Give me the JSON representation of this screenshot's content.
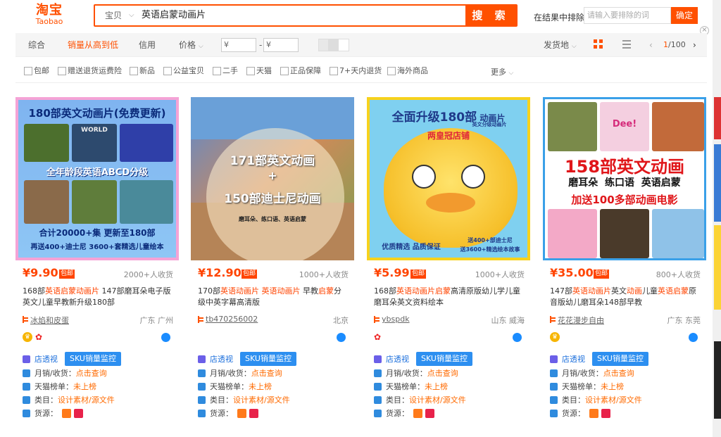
{
  "logo": {
    "cn": "淘宝",
    "en": "Taobao"
  },
  "search": {
    "scope": "宝贝",
    "query": "英语启蒙动画片",
    "button": "搜 索"
  },
  "exclude": {
    "label": "在结果中排除",
    "placeholder": "请输入要排除的词",
    "button": "确定"
  },
  "sort": {
    "items": [
      "综合",
      "销量从高到低",
      "信用",
      "价格"
    ],
    "active_index": 1,
    "price_from": "¥",
    "price_to": "¥",
    "ship_from": "发货地",
    "page_current": "1",
    "page_total": "/100"
  },
  "filters": [
    "包邮",
    "赠送退货运费险",
    "新品",
    "公益宝贝",
    "二手",
    "天猫",
    "正品保障",
    "7+天内退货",
    "海外商品"
  ],
  "filters_more": "更多",
  "tools": {
    "shop_view": "店透视",
    "sku": "SKU销量监控",
    "monthly_label": "月销/收货：",
    "monthly_value": "点击查询",
    "tmall_label": "天猫榜单：",
    "tmall_value": "未上榜",
    "category_label": "类目：",
    "category_value": "设计素材/源文件",
    "source_label": "货源："
  },
  "products": [
    {
      "poster_lines": [
        "180部英文动画片(免费更新)",
        "WORLD",
        "全年龄段英语ABCD分级",
        "合计20000+集  更新至180部",
        "再送400+迪士尼  3600+套精选儿童绘本"
      ],
      "price": "¥9.90",
      "baoyou": "包邮",
      "sold": "2000+人收货",
      "title_segments": [
        [
          "168部",
          ""
        ],
        [
          "英语启蒙动画片",
          "hl"
        ],
        [
          " 147部磨耳朵电子版英文儿童早教新升级180部",
          ""
        ]
      ],
      "shop": "冰焰和皮蛋",
      "location": "广东 广州",
      "badges": [
        "crown",
        "flower",
        "wangwang"
      ]
    },
    {
      "poster_lines": [
        "171部英文动画",
        "+",
        "150部迪士尼动画",
        "磨耳朵、练口语、英语启蒙"
      ],
      "price": "¥12.90",
      "baoyou": "包邮",
      "sold": "1000+人收货",
      "title_segments": [
        [
          "170部",
          ""
        ],
        [
          "英语动画片",
          "hl"
        ],
        [
          " ",
          ""
        ],
        [
          "英语动画片",
          "hl"
        ],
        [
          " 早教",
          ""
        ],
        [
          "启蒙",
          "hl"
        ],
        [
          "分级中英字幕高清版",
          ""
        ]
      ],
      "shop": "tb470256002",
      "location": "北京",
      "badges": [
        "wangwang"
      ]
    },
    {
      "poster_lines": [
        "全面升级180部",
        "动画片",
        "英文分级动画片",
        "两皇冠店铺",
        "优质精选 品质保证",
        "送400+部迪士尼",
        "送3600+精选绘本故事"
      ],
      "price": "¥5.99",
      "baoyou": "包邮",
      "sold": "1000+人收货",
      "title_segments": [
        [
          "168部",
          ""
        ],
        [
          "英语动画片",
          "hl"
        ],
        [
          "启蒙",
          "hl"
        ],
        [
          "高清原版幼儿学儿童磨耳朵英文资料绘本",
          ""
        ]
      ],
      "shop": "ybspdk",
      "location": "山东 威海",
      "badges": [
        "flower",
        "wangwang"
      ]
    },
    {
      "poster_lines": [
        "158部英文动画",
        "磨耳朵",
        "练口语",
        "英语启蒙",
        "加送100多部动画电影",
        "Dee!"
      ],
      "price": "¥35.00",
      "baoyou": "包邮",
      "sold": "800+人收货",
      "title_segments": [
        [
          "147部",
          ""
        ],
        [
          "英语动画片",
          "hl"
        ],
        [
          "英文",
          ""
        ],
        [
          "动画",
          "hl"
        ],
        [
          "儿童",
          ""
        ],
        [
          "英语启蒙",
          "hl"
        ],
        [
          "原音版幼儿磨耳朵148部早教",
          ""
        ]
      ],
      "shop": "花花漫步自由",
      "location": "广东 东莞",
      "badges": [
        "crown",
        "wangwang"
      ]
    }
  ],
  "colors": {
    "accent": "#ff5000",
    "price": "#ff4400",
    "tool_blue": "#2d8ff0"
  }
}
